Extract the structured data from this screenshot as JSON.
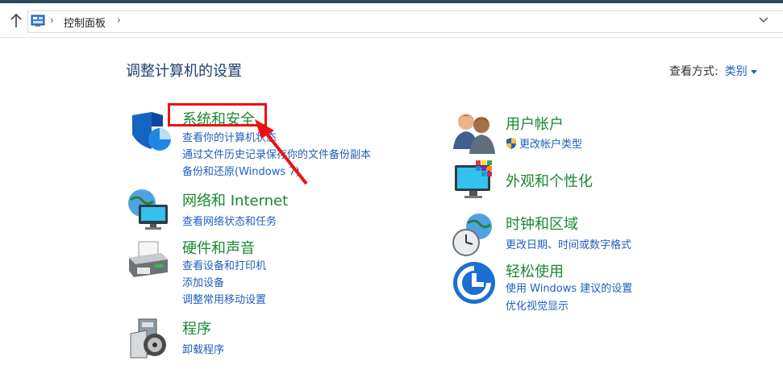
{
  "address": {
    "breadcrumb": "控制面板",
    "icons": {
      "up": "up-arrow-icon",
      "location": "control-panel-icon",
      "history": "chevron-down-icon"
    }
  },
  "main": {
    "heading": "调整计算机的设置",
    "view_by_label": "查看方式:",
    "view_by_value": "类别"
  },
  "categories_left": [
    {
      "icon": "security-shield-icon",
      "title": "系统和安全",
      "links": [
        "查看你的计算机状态",
        "通过文件历史记录保存你的文件备份副本",
        "备份和还原(Windows 7)"
      ]
    },
    {
      "icon": "network-globe-icon",
      "title": "网络和 Internet",
      "links": [
        "查看网络状态和任务"
      ]
    },
    {
      "icon": "printer-icon",
      "title": "硬件和声音",
      "links": [
        "查看设备和打印机",
        "添加设备",
        "调整常用移动设置"
      ]
    },
    {
      "icon": "programs-icon",
      "title": "程序",
      "links": [
        "卸载程序"
      ]
    }
  ],
  "categories_right": [
    {
      "icon": "users-icon",
      "title": "用户帐户",
      "links": [
        "更改帐户类型"
      ]
    },
    {
      "icon": "monitor-palette-icon",
      "title": "外观和个性化",
      "links": []
    },
    {
      "icon": "clock-globe-icon",
      "title": "时钟和区域",
      "links": [
        "更改日期、时间或数字格式"
      ]
    },
    {
      "icon": "ease-of-access-icon",
      "title": "轻松使用",
      "links": [
        "使用 Windows 建议的设置",
        "优化视觉显示"
      ]
    }
  ],
  "colors": {
    "category_title": "#19882e",
    "link": "#1f5fc0",
    "heading": "#1c3f6f",
    "annotation": "#ee1111"
  }
}
